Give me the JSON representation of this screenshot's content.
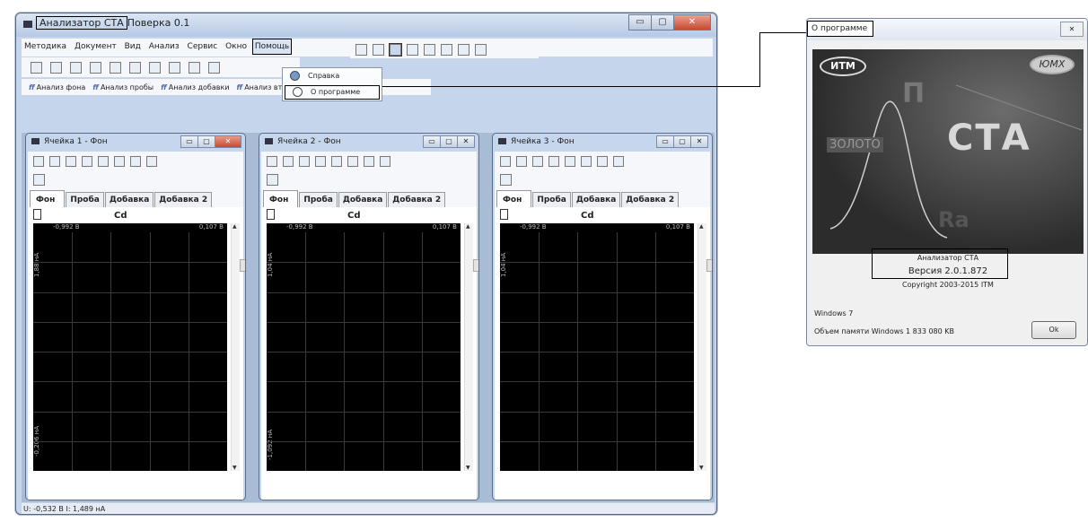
{
  "main_window": {
    "title_boxed": "Анализатор СТА",
    "title_rest": "Поверка 0.1",
    "menu": [
      "Методика",
      "Документ",
      "Вид",
      "Анализ",
      "Сервис",
      "Окно",
      "Помощь"
    ],
    "dropdown": [
      {
        "label": "Справка",
        "icon": "help-icon"
      },
      {
        "label": "О программе",
        "icon": "info-icon"
      }
    ],
    "analysis_buttons": [
      "Анализ фона",
      "Анализ пробы",
      "Анализ добавки",
      "Анализ второй добавки"
    ],
    "analysis_icons": [
      "ff",
      "ff",
      "ff",
      "ff"
    ],
    "status": "U: -0,532 В  I: 1,489 нА"
  },
  "cells": [
    {
      "title": "Ячейка 1 - Фон",
      "element": "Cd",
      "x_left": "-0,992 В",
      "x_right": "0,107 В",
      "y_top": "1,88 нА",
      "y_bottom": "-0,206 нА",
      "close_active": true
    },
    {
      "title": "Ячейка 2 - Фон",
      "element": "Cd",
      "x_left": "-0,992 В",
      "x_right": "0,107 В",
      "y_top": "1,04 нА",
      "y_bottom": "-1,092 нА",
      "close_active": false
    },
    {
      "title": "Ячейка 3 - Фон",
      "element": "Cd",
      "x_left": "-0,992 В",
      "x_right": "0,107 В",
      "y_top": "1,04 нА",
      "y_bottom": "-1,092 нА",
      "close_active": false
    }
  ],
  "tabs": [
    "Фон",
    "Проба",
    "Добавка",
    "Добавка 2"
  ],
  "about": {
    "title": "О программе",
    "close": "✕",
    "logo_left": "ИТМ",
    "logo_right": "ЮMX",
    "banner_cta": "СТА",
    "banner_zoloto": "ЗОЛОТО",
    "banner_letter": "П",
    "banner_ra": "Ra",
    "app_name": "Анализатор СТА",
    "version": "Версия  2.0.1.872",
    "copyright": "Copyright  2003-2015  ITM",
    "os": "Windows  7",
    "memory": "Объем памяти Windows   1 833 080 KB",
    "ok": "Ok"
  },
  "colors": {
    "accent": "#c4d5ec",
    "plot_bg": "#000000",
    "close_red": "#c9492f"
  }
}
